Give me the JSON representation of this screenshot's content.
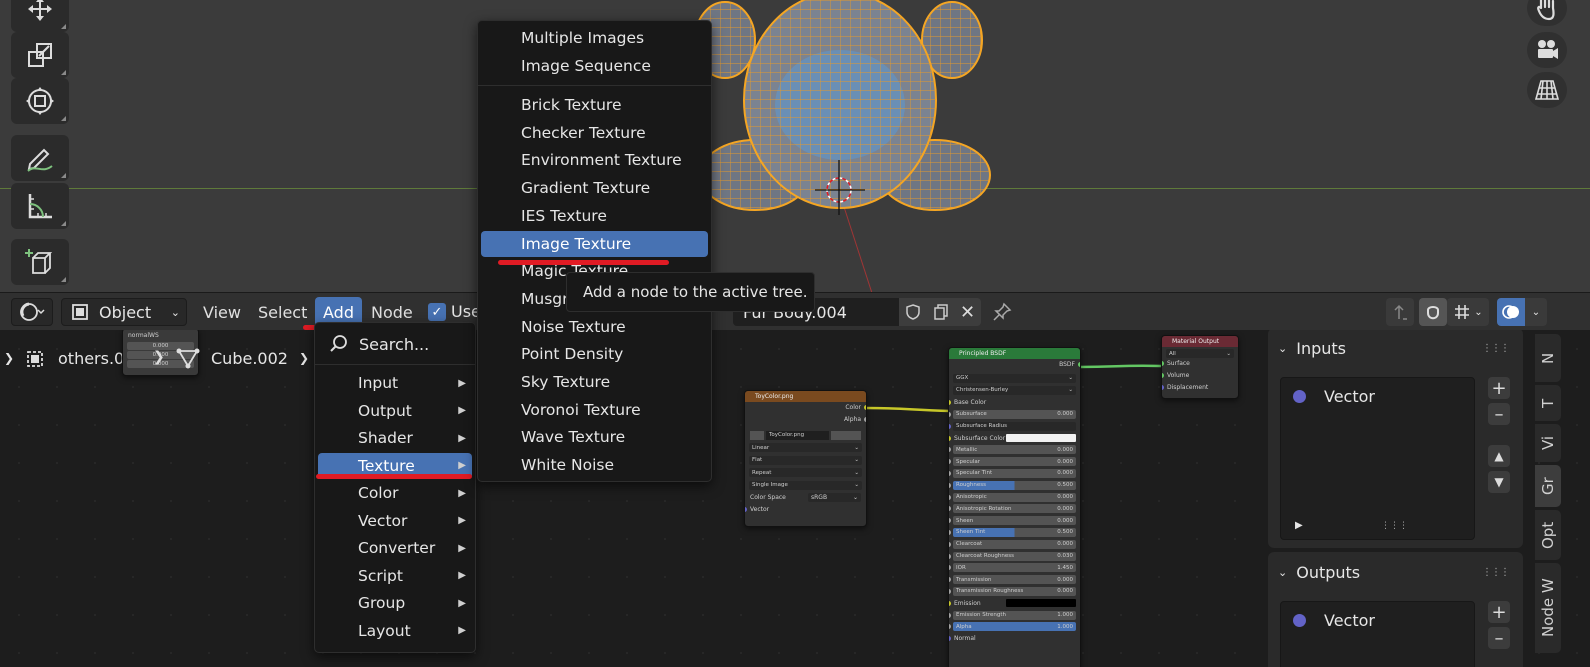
{
  "header": {
    "editor_type_icon": "node-editor-icon",
    "object_mode": "Object",
    "menus": [
      "View",
      "Select",
      "Add",
      "Node"
    ],
    "use_nodes_label": "Use",
    "material_name": "Fur Body.004"
  },
  "breadcrumb": {
    "object": "others.001",
    "mesh": "Cube.002"
  },
  "add_menu": {
    "search": "Search...",
    "items": [
      "Input",
      "Output",
      "Shader",
      "Texture",
      "Color",
      "Vector",
      "Converter",
      "Script",
      "Group",
      "Layout"
    ],
    "selected": "Texture"
  },
  "texture_submenu": {
    "group1": [
      "Multiple Images",
      "Image Sequence"
    ],
    "group2": [
      "Brick Texture",
      "Checker Texture",
      "Environment Texture",
      "Gradient Texture",
      "IES Texture",
      "Image Texture",
      "Magic Texture",
      "Musgrave Texture",
      "Noise Texture",
      "Point Density",
      "Sky Texture",
      "Voronoi Texture",
      "Wave Texture",
      "White Noise"
    ],
    "selected": "Image Texture"
  },
  "tooltip": "Add a node to the active tree.",
  "mini_node": {
    "title": "normalWS",
    "values": [
      "0.000",
      "0.000",
      "0.000"
    ]
  },
  "image_node": {
    "title": "ToyColor.png",
    "outputs": [
      "Color",
      "Alpha"
    ],
    "image": "ToyColor.png",
    "interpolation": "Linear",
    "projection": "Flat",
    "extension": "Repeat",
    "source": "Single Image",
    "colorspace_label": "Color Space",
    "colorspace": "sRGB",
    "input": "Vector"
  },
  "bsdf_node": {
    "title": "Principled BSDF",
    "output": "BSDF",
    "distribution": "GGX",
    "subsurface_method": "Christensen-Burley",
    "base_color": "Base Color",
    "fields": [
      {
        "label": "Subsurface",
        "value": "0.000"
      },
      {
        "label": "Subsurface Radius",
        "value": ""
      },
      {
        "label": "Subsurface Color",
        "value": ""
      },
      {
        "label": "Metallic",
        "value": "0.000"
      },
      {
        "label": "Specular",
        "value": "0.000"
      },
      {
        "label": "Specular Tint",
        "value": "0.000"
      },
      {
        "label": "Roughness",
        "value": "0.500"
      },
      {
        "label": "Anisotropic",
        "value": "0.000"
      },
      {
        "label": "Anisotropic Rotation",
        "value": "0.000"
      },
      {
        "label": "Sheen",
        "value": "0.000"
      },
      {
        "label": "Sheen Tint",
        "value": "0.500"
      },
      {
        "label": "Clearcoat",
        "value": "0.000"
      },
      {
        "label": "Clearcoat Roughness",
        "value": "0.030"
      },
      {
        "label": "IOR",
        "value": "1.450"
      },
      {
        "label": "Transmission",
        "value": "0.000"
      },
      {
        "label": "Transmission Roughness",
        "value": "0.000"
      },
      {
        "label": "Emission",
        "value": ""
      },
      {
        "label": "Emission Strength",
        "value": "1.000"
      },
      {
        "label": "Alpha",
        "value": "1.000"
      },
      {
        "label": "Normal",
        "value": ""
      }
    ]
  },
  "output_node": {
    "title": "Material Output",
    "target": "All",
    "inputs": [
      "Surface",
      "Volume",
      "Displacement"
    ]
  },
  "side_panel": {
    "inputs_title": "Inputs",
    "inputs_socket": "Vector",
    "outputs_title": "Outputs",
    "outputs_socket": "Vector",
    "tabs": [
      "N",
      "T",
      "Vi",
      "Gr",
      "Opt",
      "Node W"
    ]
  },
  "colors": {
    "accent": "#4772b3",
    "wireframe": "#f5a623",
    "underline": "#e01b24"
  }
}
